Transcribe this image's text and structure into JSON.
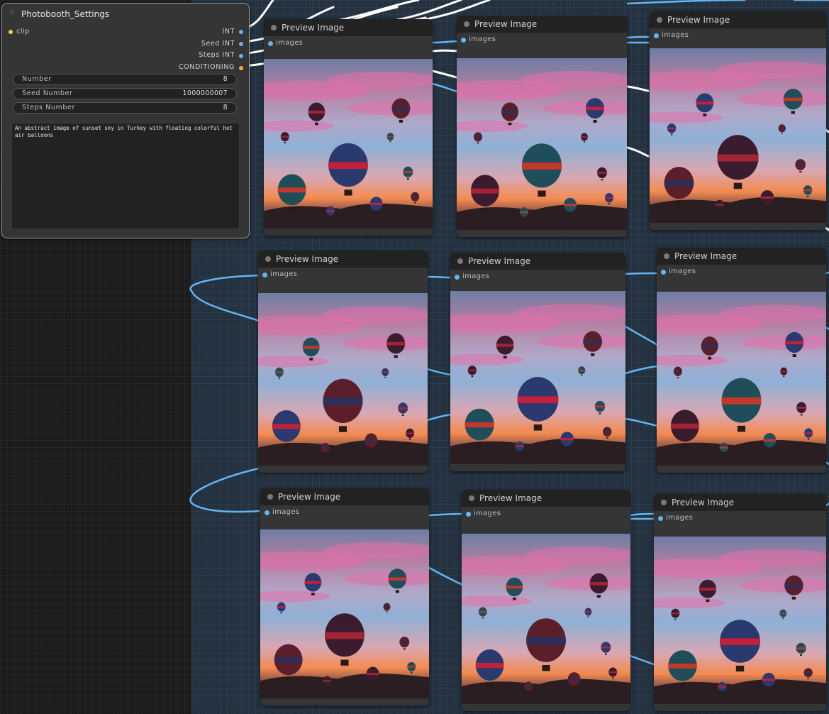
{
  "settings_node": {
    "title": "Photobooth_Settings",
    "input": {
      "label": "clip",
      "color": "#f5d142"
    },
    "outputs": [
      {
        "label": "INT",
        "color": "#64b5f6"
      },
      {
        "label": "Seed INT",
        "color": "#64b5f6"
      },
      {
        "label": "Steps INT",
        "color": "#64b5f6"
      },
      {
        "label": "CONDITIONING",
        "color": "#ffa931"
      }
    ],
    "widgets": [
      {
        "label": "Number",
        "value": "8"
      },
      {
        "label": "Seed Number",
        "value": "1000000007"
      },
      {
        "label": "Steps Number",
        "value": "8"
      }
    ],
    "prompt_text": "An abstract image of sunset sky in Turkey with floating colorful hot air balloons"
  },
  "preview_nodes": [
    {
      "title": "Preview Image",
      "slot": "images"
    },
    {
      "title": "Preview Image",
      "slot": "images"
    },
    {
      "title": "Preview Image",
      "slot": "images"
    },
    {
      "title": "Preview Image",
      "slot": "images"
    },
    {
      "title": "Preview Image",
      "slot": "images"
    },
    {
      "title": "Preview Image",
      "slot": "images"
    },
    {
      "title": "Preview Image",
      "slot": "images"
    },
    {
      "title": "Preview Image",
      "slot": "images"
    },
    {
      "title": "Preview Image",
      "slot": "images"
    }
  ],
  "colors": {
    "link_blue": "#64b5f6",
    "link_white": "#ffffff",
    "group_bg": "#243240",
    "node_bg": "#353535"
  }
}
